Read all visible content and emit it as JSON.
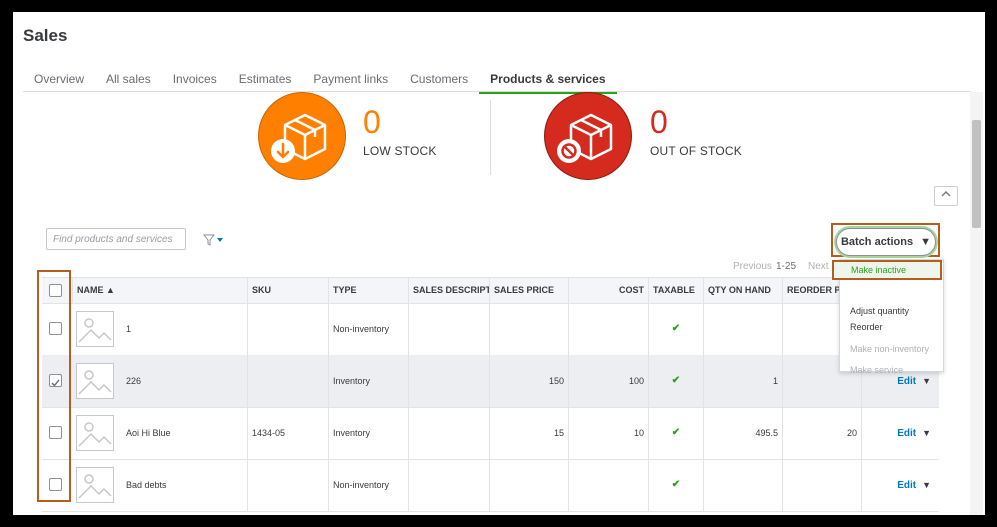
{
  "page": {
    "title": "Sales"
  },
  "tabs": [
    {
      "label": "Overview"
    },
    {
      "label": "All sales"
    },
    {
      "label": "Invoices"
    },
    {
      "label": "Estimates"
    },
    {
      "label": "Payment links"
    },
    {
      "label": "Customers"
    },
    {
      "label": "Products & services",
      "active": true
    }
  ],
  "stock": {
    "low": {
      "count": "0",
      "label": "LOW STOCK",
      "color": "#ff8000"
    },
    "out": {
      "count": "0",
      "label": "OUT OF STOCK",
      "color": "#d52b1e"
    }
  },
  "toolbar": {
    "search_placeholder": "Find products and services",
    "batch_label": "Batch actions",
    "filter_icon": "funnel-icon",
    "collapse_icon": "chevron-up-icon"
  },
  "pager": {
    "previous": "Previous",
    "range": "1-25",
    "next": "Next"
  },
  "batch_menu": {
    "items": [
      {
        "label": "Make inactive",
        "enabled": true,
        "highlighted": true
      },
      {
        "label": "Adjust quantity",
        "enabled": true
      },
      {
        "label": "Reorder",
        "enabled": true
      },
      {
        "label": "Make non-inventory",
        "enabled": false
      },
      {
        "label": "Make service",
        "enabled": false
      }
    ]
  },
  "table": {
    "columns": [
      "NAME ▲",
      "SKU",
      "TYPE",
      "SALES DESCRIPTION",
      "SALES PRICE",
      "COST",
      "TAXABLE",
      "QTY ON HAND",
      "REORDER POINT"
    ],
    "rows": [
      {
        "name": "1",
        "sku": "",
        "type": "Non-inventory",
        "desc": "",
        "price": "",
        "cost": "",
        "taxable": "✔",
        "qty": "",
        "reorder": "",
        "checked": false,
        "action": ""
      },
      {
        "name": "226",
        "sku": "",
        "type": "Inventory",
        "desc": "",
        "price": "150",
        "cost": "100",
        "taxable": "✔",
        "qty": "1",
        "reorder": "",
        "checked": true,
        "action": "Edit"
      },
      {
        "name": "Aoi Hi Blue",
        "sku": "1434-05",
        "type": "Inventory",
        "desc": "",
        "price": "15",
        "cost": "10",
        "taxable": "✔",
        "qty": "495.5",
        "reorder": "20",
        "checked": false,
        "action": "Edit"
      },
      {
        "name": "Bad debts",
        "sku": "",
        "type": "Non-inventory",
        "desc": "",
        "price": "",
        "cost": "",
        "taxable": "✔",
        "qty": "",
        "reorder": "",
        "checked": false,
        "action": "Edit"
      }
    ]
  },
  "colors": {
    "brand_green": "#2ca01c",
    "link_blue": "#0077c5",
    "annotation_box": "#b65c1c"
  }
}
